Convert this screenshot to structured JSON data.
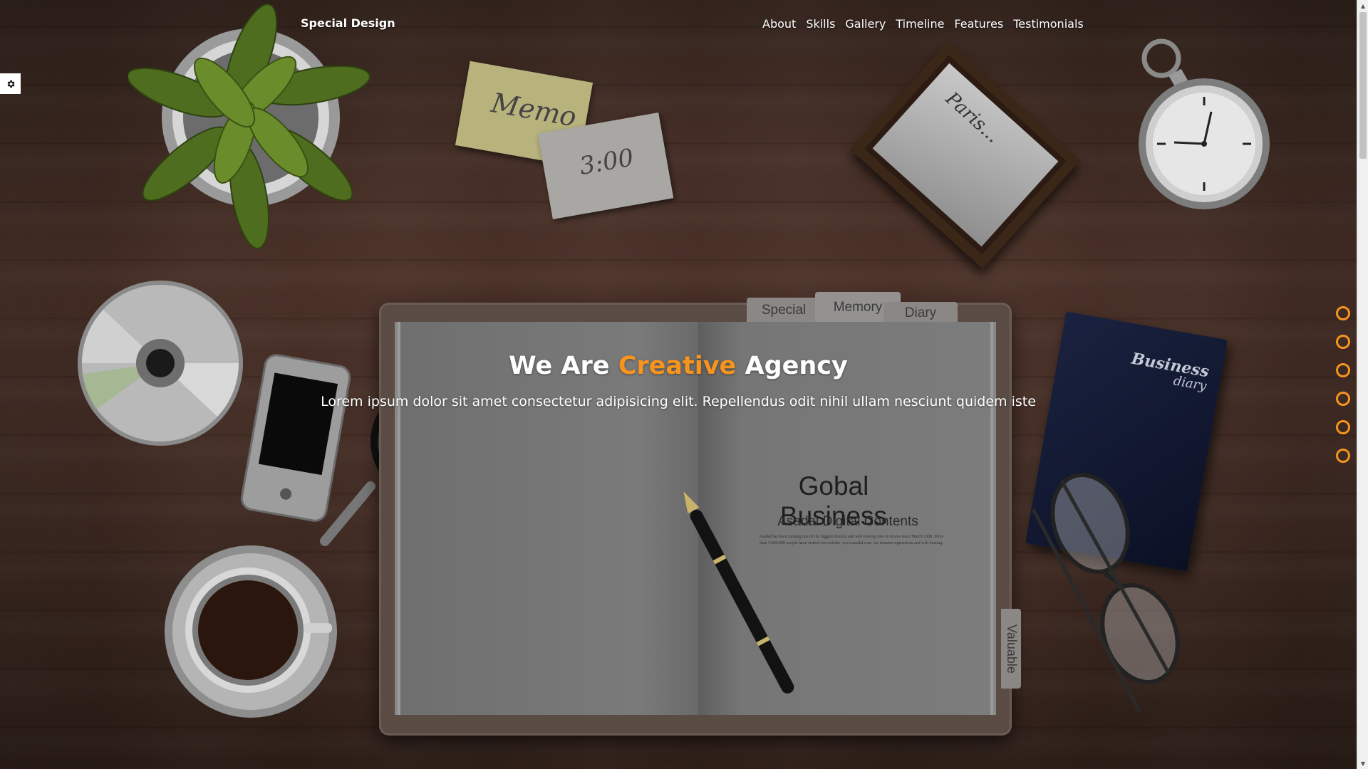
{
  "nav": {
    "brand": "Special Design",
    "items": [
      {
        "label": "About"
      },
      {
        "label": "Skills"
      },
      {
        "label": "Gallery"
      },
      {
        "label": "Timeline"
      },
      {
        "label": "Features"
      },
      {
        "label": "Testimonials"
      }
    ]
  },
  "hero": {
    "title_start": "We Are ",
    "title_accent": "Creative",
    "title_end": " Agency",
    "text": "Lorem ipsum dolor sit amet consectetur adipisicing elit. Repellendus odit nihil ullam nesciunt quidem iste"
  },
  "decor": {
    "note1": "Memo",
    "note2": "3:00",
    "frame": "Paris...",
    "tabs": [
      "Special",
      "Memory",
      "Diary"
    ],
    "tab_side": "Valuable",
    "book_title": "Gobal Business",
    "book_sub": "Asadal Digital Contents",
    "book_small": "Asadal has been running one of the biggest domain and web hosting sites in Korea since March 1998. More than 3,000,000 people have visited our website, www.asadal.com, for domain registration and web hosting.",
    "diary_line1": "Business",
    "diary_line2": "diary"
  },
  "bullets": 6,
  "colors": {
    "accent": "#f7941d",
    "background": "#432d25"
  },
  "icons": {
    "settings": "gear-icon"
  }
}
